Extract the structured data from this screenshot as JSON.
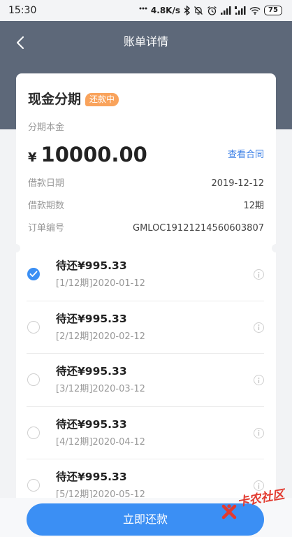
{
  "status_bar": {
    "time": "15:30",
    "network_speed": "4.8K/s",
    "battery": "75",
    "icons": [
      "more-dots-icon",
      "bluetooth-icon",
      "mute-icon",
      "alarm-icon",
      "signal-icon",
      "hd-signal-icon",
      "wifi-icon",
      "battery-icon"
    ]
  },
  "header": {
    "title": "账单详情",
    "back_icon": "chevron-left-icon"
  },
  "summary": {
    "product_name": "现金分期",
    "status_badge": "还款中",
    "principal_label": "分期本金",
    "currency": "¥",
    "principal_amount": "10000.00",
    "contract_link": "查看合同",
    "rows": [
      {
        "label": "借款日期",
        "value": "2019-12-12"
      },
      {
        "label": "借款期数",
        "value": "12期"
      },
      {
        "label": "订单编号",
        "value": "GMLOC19121214560603807"
      }
    ]
  },
  "installments": [
    {
      "title": "待还¥995.33",
      "period": "[1/12期]2020-01-12",
      "checked": true
    },
    {
      "title": "待还¥995.33",
      "period": "[2/12期]2020-02-12",
      "checked": false
    },
    {
      "title": "待还¥995.33",
      "period": "[3/12期]2020-03-12",
      "checked": false
    },
    {
      "title": "待还¥995.33",
      "period": "[4/12期]2020-04-12",
      "checked": false
    },
    {
      "title": "待还¥995.33",
      "period": "[5/12期]2020-05-12",
      "checked": false
    }
  ],
  "footer": {
    "pay_button": "立即还款"
  },
  "watermark": {
    "text": "卡农社区"
  },
  "colors": {
    "accent": "#3b8ff4",
    "header_bg": "#5d6879",
    "badge_bg": "#f9a35c",
    "link": "#3b7fe6"
  }
}
